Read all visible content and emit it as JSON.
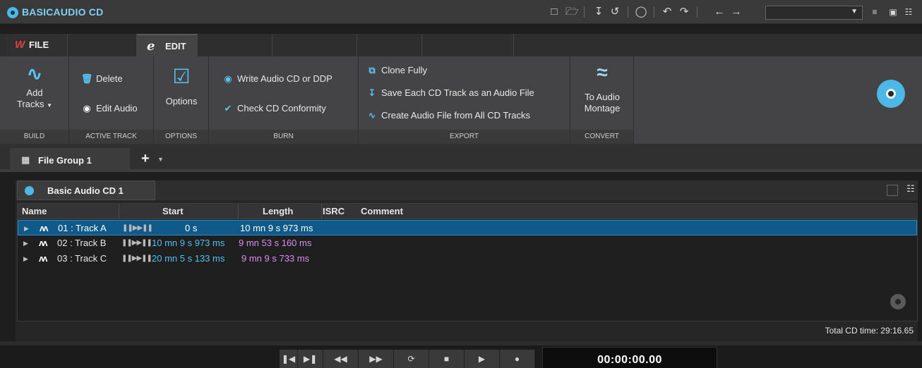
{
  "window": {
    "title": "BASICAUDIO CD",
    "preset_select_value": ""
  },
  "ribbon": {
    "tabs": [
      {
        "label": "FILE",
        "glyph": "W"
      },
      {
        "label": "EDIT",
        "glyph": "e"
      }
    ],
    "groups": {
      "build": {
        "footer": "BUILD",
        "add_tracks_line1": "Add",
        "add_tracks_line2": "Tracks"
      },
      "active_track": {
        "footer": "ACTIVE TRACK",
        "delete": "Delete",
        "edit_audio": "Edit Audio"
      },
      "options": {
        "footer": "OPTIONS",
        "options": "Options"
      },
      "burn": {
        "footer": "BURN",
        "write": "Write Audio CD or DDP",
        "check": "Check CD Conformity"
      },
      "export": {
        "footer": "EXPORT",
        "clone": "Clone Fully",
        "save_each": "Save Each CD Track as an Audio File",
        "create_file": "Create Audio File from All CD Tracks"
      },
      "convert": {
        "footer": "CONVERT",
        "to_montage_line1": "To Audio",
        "to_montage_line2": "Montage"
      }
    }
  },
  "file_group": {
    "tab_label": "File Group 1",
    "add_label": "+"
  },
  "document": {
    "tab_label": "Basic Audio CD 1",
    "columns": [
      "Name",
      "Start",
      "Length",
      "ISRC",
      "Comment"
    ],
    "tracks": [
      {
        "name": "01 : Track A",
        "start": "0 s",
        "length": "10 mn 9 s 973 ms",
        "isrc": "",
        "comment": ""
      },
      {
        "name": "02 : Track B",
        "start": "10 mn 9 s 973 ms",
        "length": "9 mn 53 s 160 ms",
        "isrc": "",
        "comment": ""
      },
      {
        "name": "03 : Track C",
        "start": "20 mn 5 s 133 ms",
        "length": "9 mn 9 s 733 ms",
        "isrc": "",
        "comment": ""
      }
    ],
    "selected_track_index": 0,
    "total_label": "Total CD time: 29:16.65"
  },
  "transport": {
    "timecode": "00:00:00.00",
    "buttons": [
      "go-to-start",
      "go-to-end",
      "rewind",
      "fast-forward",
      "loop",
      "stop",
      "play",
      "record"
    ]
  },
  "colors": {
    "accent": "#4bb8e8",
    "start_time": "#4cc3f4",
    "length_time": "#d88ef0",
    "selection": "#0f5a88",
    "file_tab_glyph": "#e0413f"
  }
}
